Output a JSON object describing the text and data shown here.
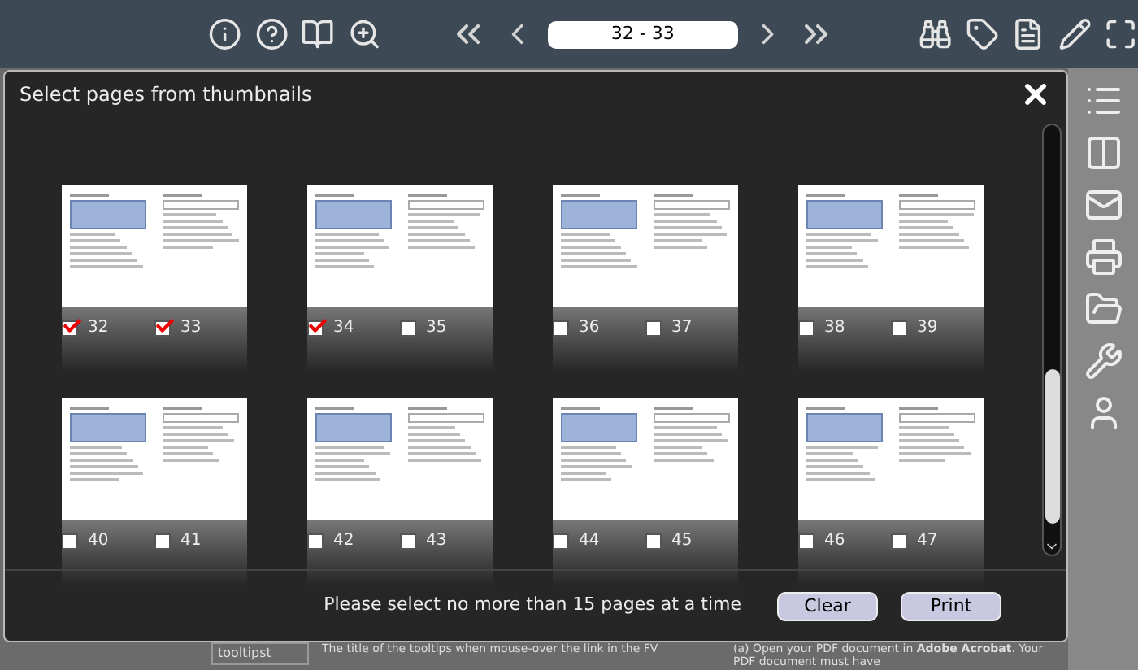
{
  "toolbar": {
    "page_field": {
      "value": "32 - 33"
    }
  },
  "dialog": {
    "title": "Select pages from thumbnails",
    "rows": [
      {
        "spreads": [
          {
            "pages": [
              {
                "number": "32",
                "checked": true
              },
              {
                "number": "33",
                "checked": true
              }
            ]
          },
          {
            "pages": [
              {
                "number": "34",
                "checked": true
              },
              {
                "number": "35",
                "checked": false
              }
            ]
          },
          {
            "pages": [
              {
                "number": "36",
                "checked": false
              },
              {
                "number": "37",
                "checked": false
              }
            ]
          },
          {
            "pages": [
              {
                "number": "38",
                "checked": false
              },
              {
                "number": "39",
                "checked": false
              }
            ]
          }
        ]
      },
      {
        "spreads": [
          {
            "pages": [
              {
                "number": "40",
                "checked": false
              },
              {
                "number": "41",
                "checked": false
              }
            ]
          },
          {
            "pages": [
              {
                "number": "42",
                "checked": false
              },
              {
                "number": "43",
                "checked": false
              }
            ]
          },
          {
            "pages": [
              {
                "number": "44",
                "checked": false
              },
              {
                "number": "45",
                "checked": false
              }
            ]
          },
          {
            "pages": [
              {
                "number": "46",
                "checked": false
              },
              {
                "number": "47",
                "checked": false
              }
            ]
          }
        ]
      }
    ],
    "message": "Please select no more than 15 pages at a time",
    "buttons": [
      "Clear",
      "Print"
    ]
  },
  "document": {
    "table_cell": "tooltipst",
    "table_text": "The title of the tooltips when mouse-over the link in the FV",
    "paragraph": "(a) Open your PDF document in **Adobe Acrobat**. Your PDF document must have"
  }
}
